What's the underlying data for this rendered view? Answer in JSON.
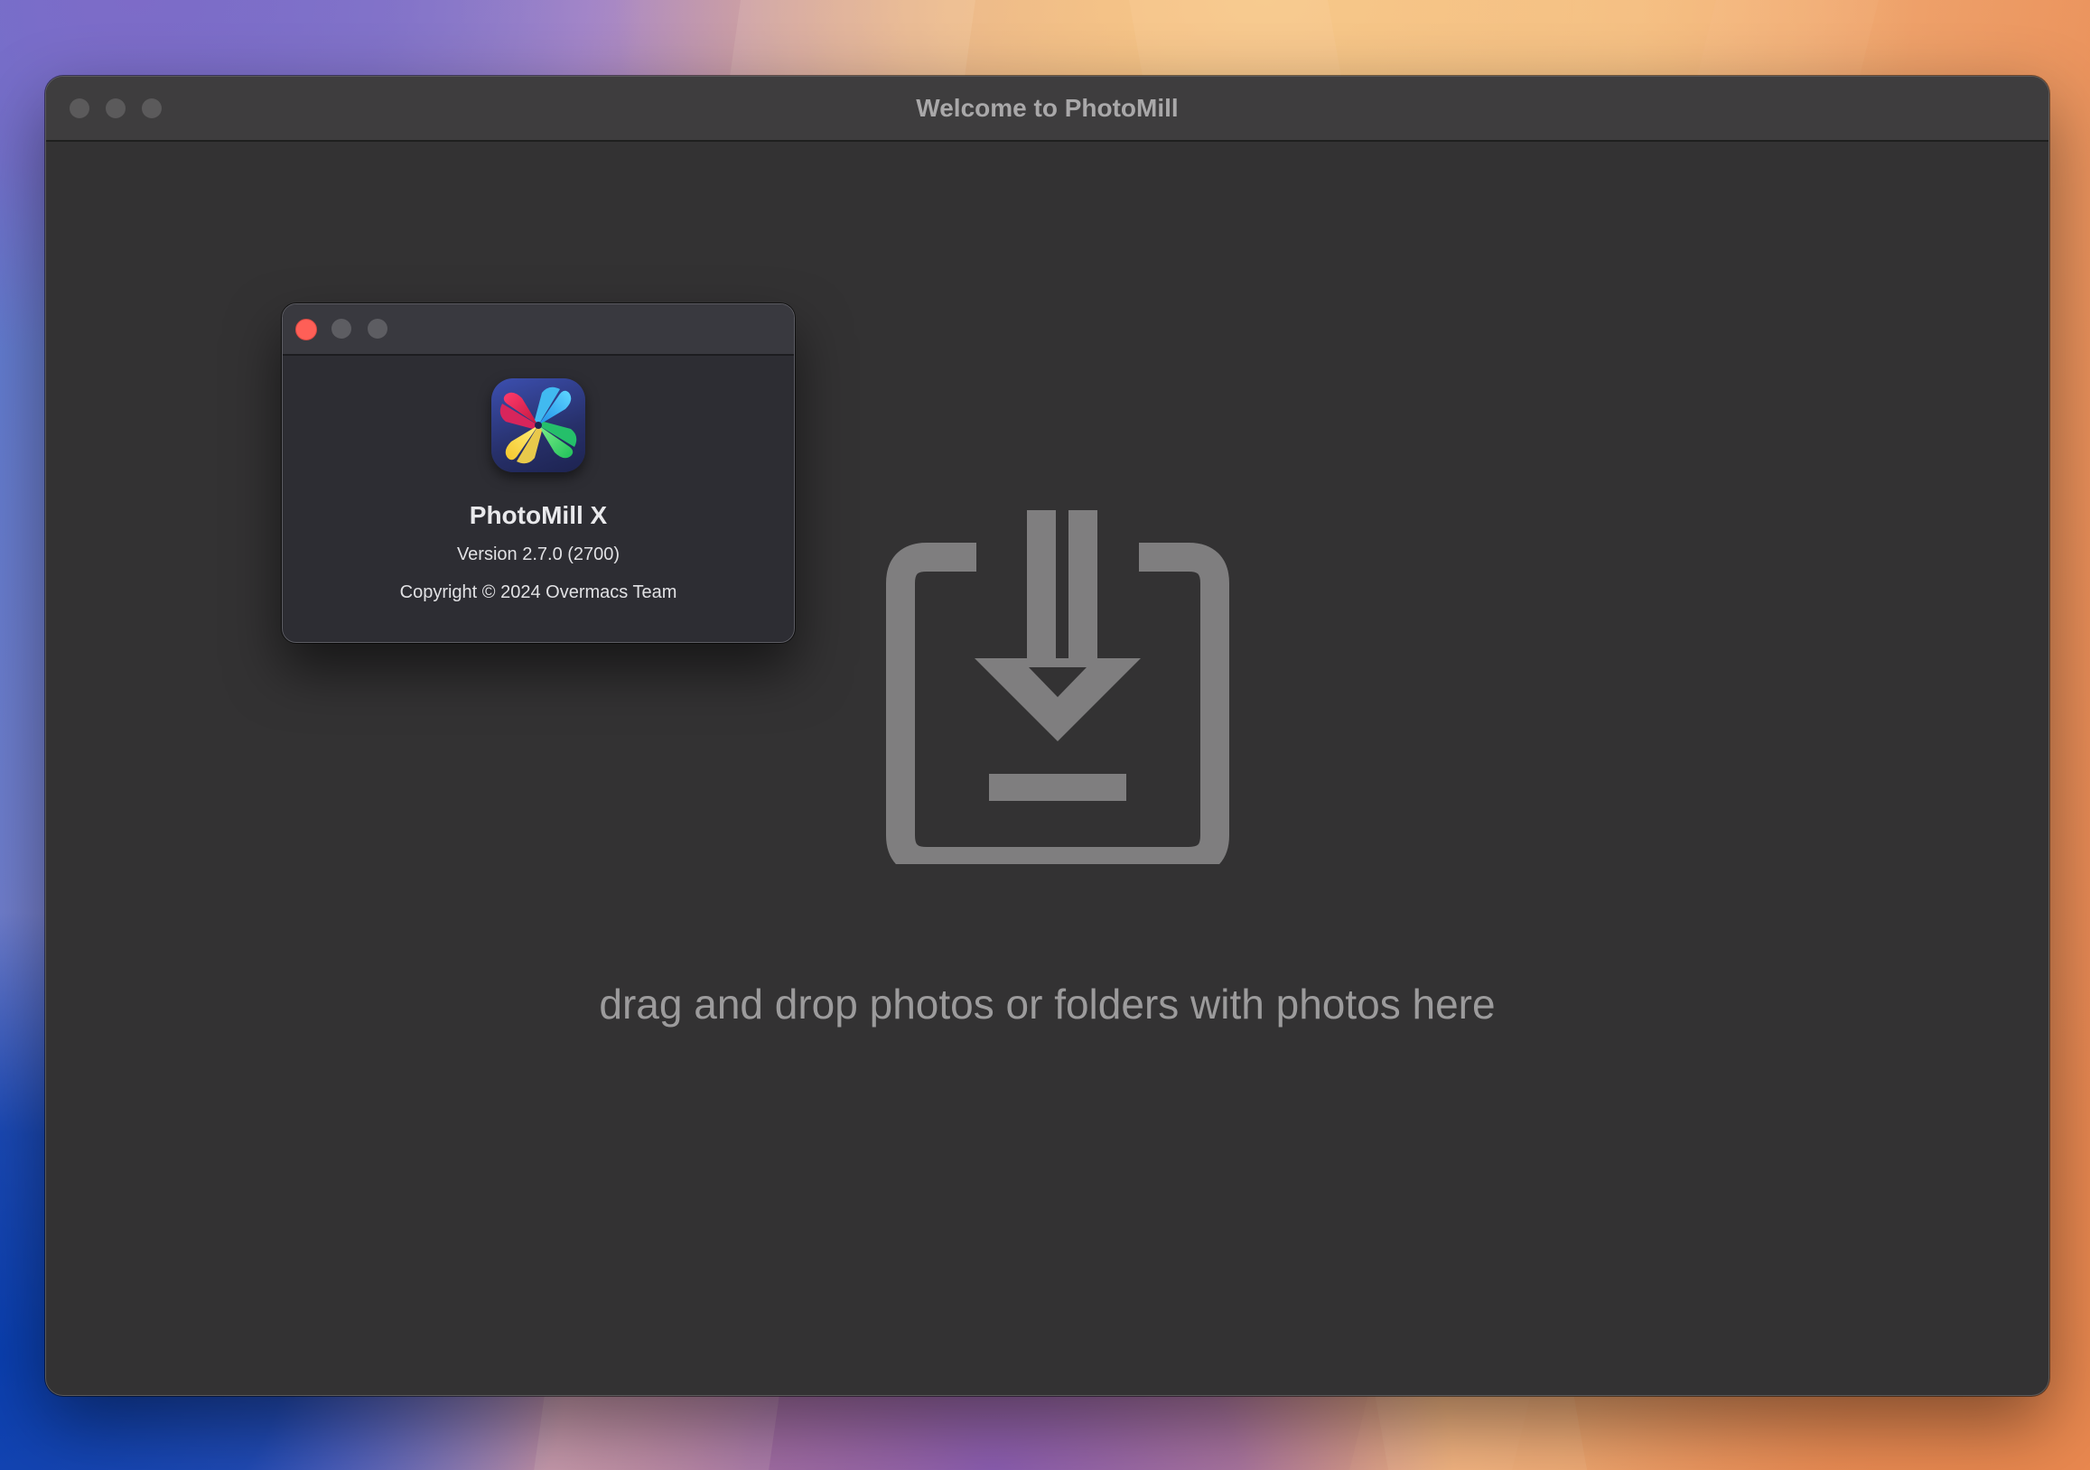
{
  "main_window": {
    "title": "Welcome to PhotoMill",
    "drop_zone": {
      "icon": "download-tray-icon",
      "text": "drag and drop photos or folders with photos here"
    }
  },
  "about_window": {
    "app_icon": "photomill-pinwheel-icon",
    "app_name": "PhotoMill X",
    "version": "Version 2.7.0 (2700)",
    "copyright": "Copyright © 2024 Overmacs Team"
  },
  "colors": {
    "close_red": "#fe5f57",
    "inactive_gray": "#5b5a5b",
    "window_bg": "#333233",
    "drop_icon_gray": "#7f7e7f"
  }
}
